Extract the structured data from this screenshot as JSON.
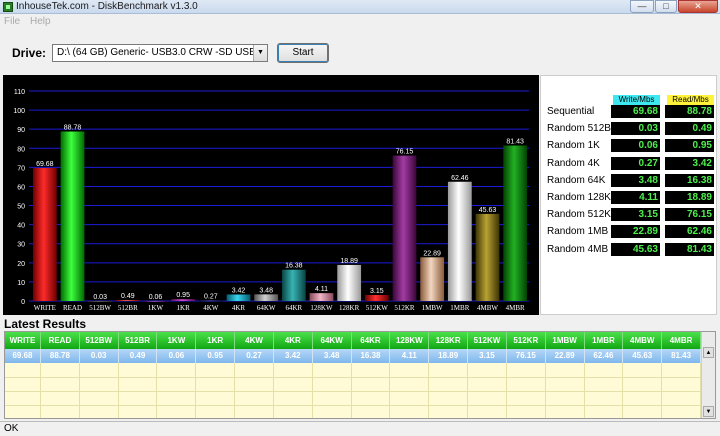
{
  "window": {
    "title": "InhouseTek.com - DiskBenchmark v1.3.0"
  },
  "menu": {
    "file": "File",
    "help": "Help"
  },
  "drive": {
    "label": "Drive:",
    "value": "D:\\ (64 GB) Generic- USB3.0 CRW   -SD USB Dev"
  },
  "start_label": "Start",
  "chart_data": {
    "type": "bar",
    "ylim": [
      0,
      110
    ],
    "yticks": [
      0,
      10,
      20,
      30,
      40,
      50,
      60,
      70,
      80,
      90,
      100,
      110
    ],
    "categories": [
      "WRITE",
      "READ",
      "512BW",
      "512BR",
      "1KW",
      "1KR",
      "4KW",
      "4KR",
      "64KW",
      "64KR",
      "128KW",
      "128KR",
      "512KW",
      "512KR",
      "1MBW",
      "1MBR",
      "4MBW",
      "4MBR"
    ],
    "values": [
      69.68,
      88.78,
      0.03,
      0.49,
      0.06,
      0.95,
      0.27,
      3.42,
      3.48,
      16.38,
      4.11,
      18.89,
      3.15,
      76.15,
      22.89,
      62.46,
      45.63,
      81.43
    ],
    "labels": [
      "69.68",
      "88.78",
      "0.03",
      "0.49",
      "0.06",
      "0.95",
      "0.27",
      "3.42",
      "3.48",
      "16.38",
      "4.11",
      "18.89",
      "3.15",
      "76.15",
      "22.89",
      "62.46",
      "45.63",
      "81.43"
    ],
    "colors": [
      [
        "#ff2a2a",
        "#6e0000"
      ],
      [
        "#3dff3d",
        "#006b00"
      ],
      [
        "#7a7a7a",
        "#333333"
      ],
      [
        "#ff5c5c",
        "#7a0000"
      ],
      [
        "#b46bff",
        "#3d0a7a"
      ],
      [
        "#d24ad2",
        "#5a0a5a"
      ],
      [
        "#5a5aff",
        "#12124a"
      ],
      [
        "#36d6f0",
        "#055a6e"
      ],
      [
        "#d0d0d0",
        "#555555"
      ],
      [
        "#38b3b3",
        "#0a4343"
      ],
      [
        "#f2b6c9",
        "#8a4a5c"
      ],
      [
        "#ffffff",
        "#9a9a9a"
      ],
      [
        "#ff3030",
        "#6a0000"
      ],
      [
        "#a33ca3",
        "#3a063a"
      ],
      [
        "#f2d6c0",
        "#8a5a3a"
      ],
      [
        "#ffffff",
        "#9a9a9a"
      ],
      [
        "#b8a232",
        "#3d3405"
      ],
      [
        "#22b122",
        "#034203"
      ]
    ]
  },
  "results": {
    "write_header": "Write/Mbs",
    "read_header": "Read/Mbs",
    "header_colors": {
      "write": "#3ee8f0",
      "read": "#fff23a"
    },
    "rows": [
      {
        "label": "Sequential",
        "write": "69.68",
        "read": "88.78"
      },
      {
        "label": "Random 512B",
        "write": "0.03",
        "read": "0.49"
      },
      {
        "label": "Random 1K",
        "write": "0.06",
        "read": "0.95"
      },
      {
        "label": "Random 4K",
        "write": "0.27",
        "read": "3.42"
      },
      {
        "label": "Random 64K",
        "write": "3.48",
        "read": "16.38"
      },
      {
        "label": "Random 128K",
        "write": "4.11",
        "read": "18.89"
      },
      {
        "label": "Random 512K",
        "write": "3.15",
        "read": "76.15"
      },
      {
        "label": "Random 1MB",
        "write": "22.89",
        "read": "62.46"
      },
      {
        "label": "Random 4MB",
        "write": "45.63",
        "read": "81.43"
      }
    ]
  },
  "latest": {
    "title": "Latest Results",
    "headers": [
      "WRITE",
      "READ",
      "512BW",
      "512BR",
      "1KW",
      "1KR",
      "4KW",
      "4KR",
      "64KW",
      "64KR",
      "128KW",
      "128KR",
      "512KW",
      "512KR",
      "1MBW",
      "1MBR",
      "4MBW",
      "4MBR"
    ],
    "row": [
      "69.68",
      "88.78",
      "0.03",
      "0.49",
      "0.06",
      "0.95",
      "0.27",
      "3.42",
      "3.48",
      "16.38",
      "4.11",
      "18.89",
      "3.15",
      "76.15",
      "22.89",
      "62.46",
      "45.63",
      "81.43"
    ]
  },
  "status": "OK"
}
